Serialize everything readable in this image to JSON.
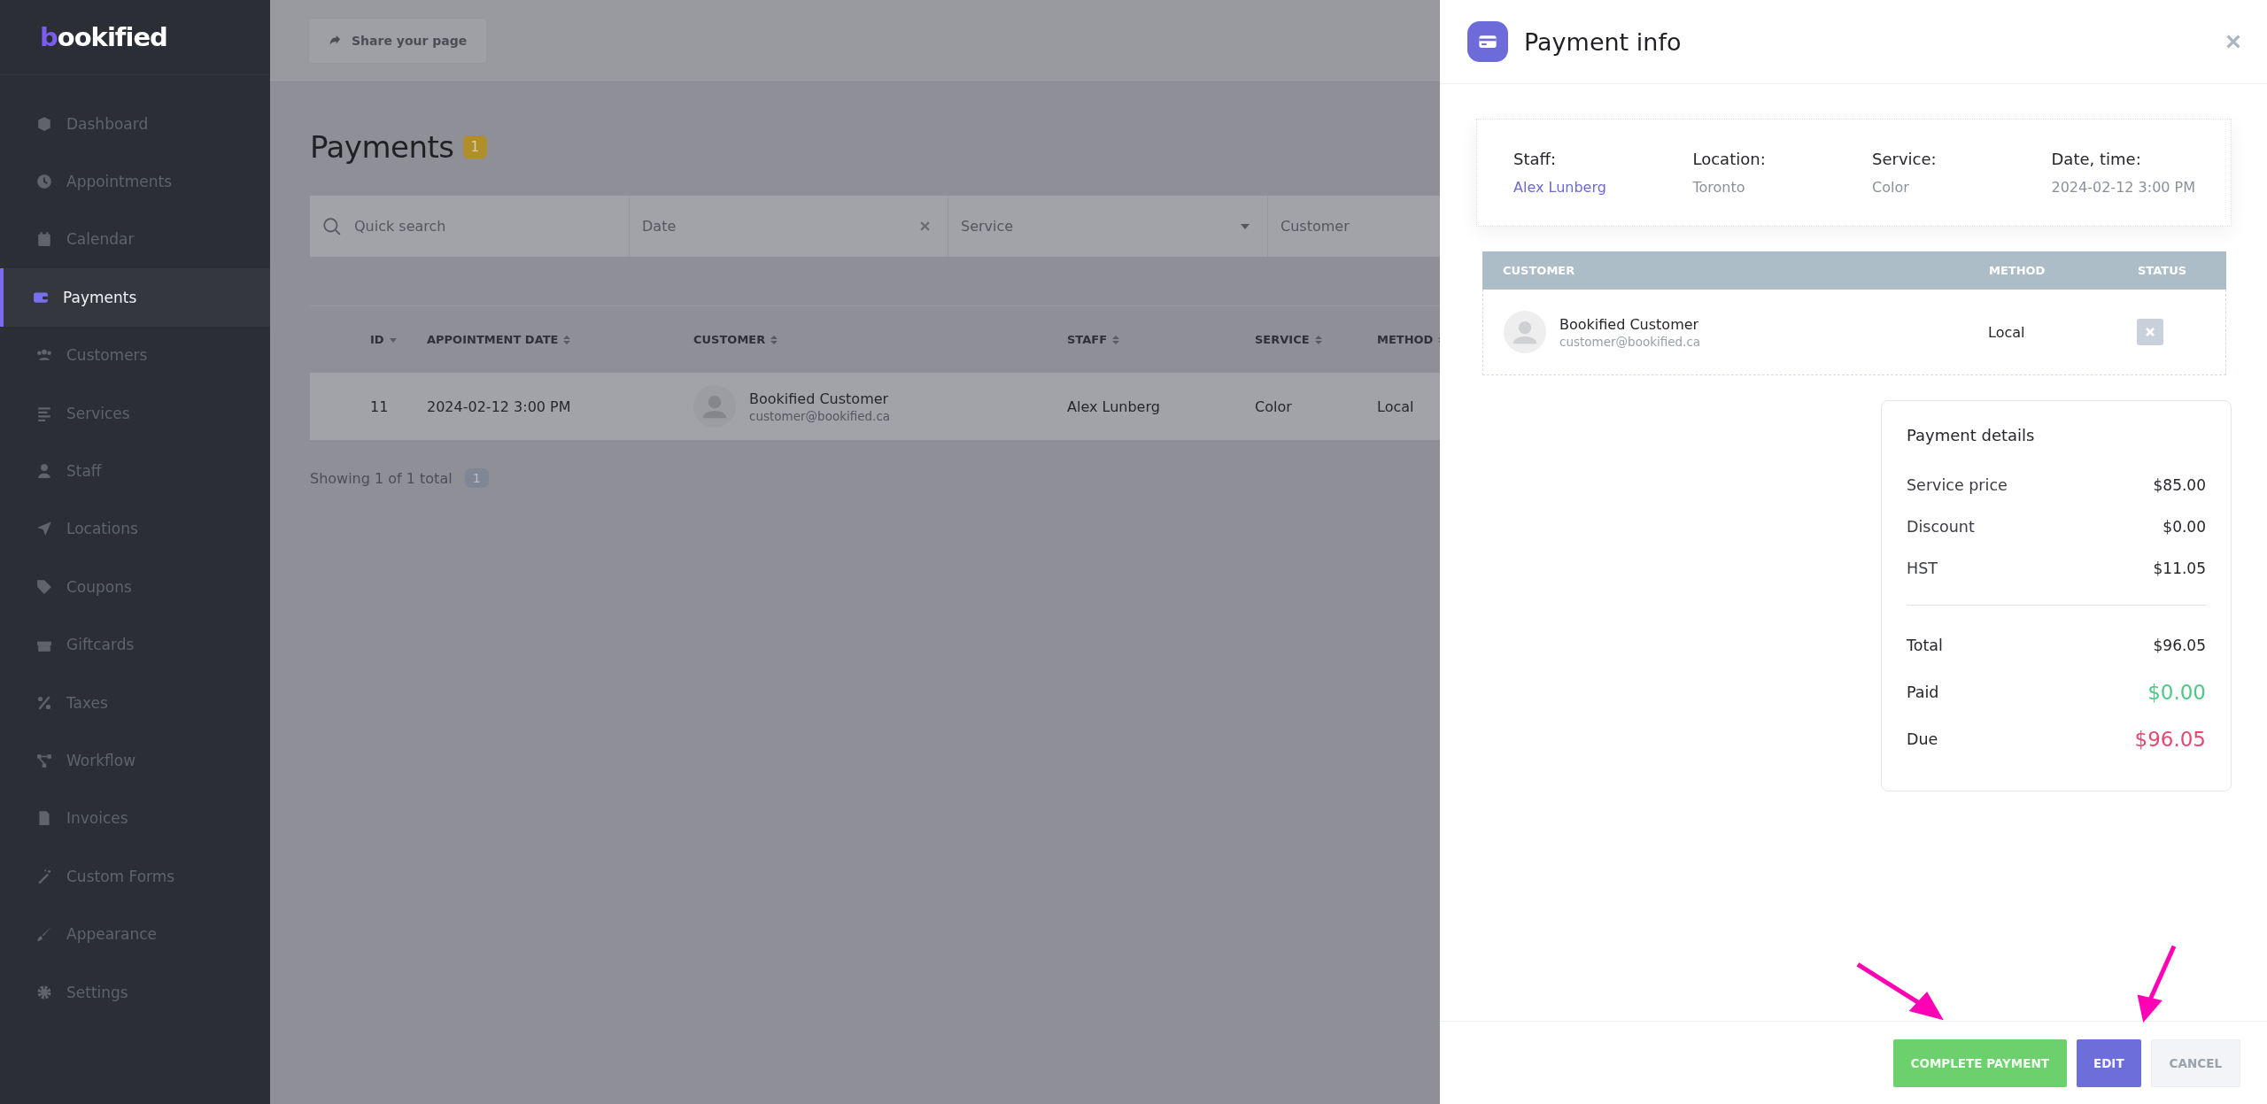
{
  "brand": {
    "mark": "b",
    "name": "ookified"
  },
  "sidebar": {
    "items": [
      {
        "label": "Dashboard",
        "selected": false
      },
      {
        "label": "Appointments",
        "selected": false
      },
      {
        "label": "Calendar",
        "selected": false
      },
      {
        "label": "Payments",
        "selected": true
      },
      {
        "label": "Customers",
        "selected": false
      },
      {
        "label": "Services",
        "selected": false
      },
      {
        "label": "Staff",
        "selected": false
      },
      {
        "label": "Locations",
        "selected": false
      },
      {
        "label": "Coupons",
        "selected": false
      },
      {
        "label": "Giftcards",
        "selected": false
      },
      {
        "label": "Taxes",
        "selected": false
      },
      {
        "label": "Workflow",
        "selected": false
      },
      {
        "label": "Invoices",
        "selected": false
      },
      {
        "label": "Custom Forms",
        "selected": false
      },
      {
        "label": "Appearance",
        "selected": false
      },
      {
        "label": "Settings",
        "selected": false
      }
    ]
  },
  "topbar": {
    "share_button": "Share your page"
  },
  "page": {
    "title": "Payments",
    "count": "1"
  },
  "filters": [
    {
      "kind": "search",
      "placeholder": "Quick search"
    },
    {
      "kind": "clearable",
      "placeholder": "Date"
    },
    {
      "kind": "dropdown",
      "placeholder": "Service"
    },
    {
      "kind": "plain",
      "placeholder": "Customer"
    }
  ],
  "table": {
    "columns": [
      {
        "label": "ID",
        "sorted": true
      },
      {
        "label": "APPOINTMENT DATE",
        "sorted": false
      },
      {
        "label": "CUSTOMER",
        "sorted": false
      },
      {
        "label": "STAFF",
        "sorted": false
      },
      {
        "label": "SERVICE",
        "sorted": false
      },
      {
        "label": "METHOD",
        "sorted": false
      }
    ],
    "rows": [
      {
        "id": "11",
        "date": "2024-02-12 3:00 PM",
        "customer_name": "Bookified Customer",
        "customer_email": "customer@bookified.ca",
        "staff": "Alex Lunberg",
        "service": "Color",
        "method": "Local"
      }
    ]
  },
  "footer": {
    "showing": "Showing 1 of 1 total",
    "page": "1"
  },
  "panel": {
    "title": "Payment info",
    "info": [
      {
        "label": "Staff:",
        "value": "Alex Lunberg",
        "kind": "link"
      },
      {
        "label": "Location:",
        "value": "Toronto",
        "kind": "text"
      },
      {
        "label": "Service:",
        "value": "Color",
        "kind": "text"
      },
      {
        "label": "Date, time:",
        "value": "2024-02-12 3:00 PM",
        "kind": "text"
      }
    ],
    "customers": {
      "columns": [
        "CUSTOMER",
        "METHOD",
        "STATUS"
      ],
      "rows": [
        {
          "name": "Bookified Customer",
          "email": "customer@bookified.ca",
          "method": "Local",
          "paid": false
        }
      ]
    },
    "details": {
      "title": "Payment details",
      "lines": [
        {
          "label": "Service price",
          "value": "$85.00",
          "kind": "line"
        },
        {
          "label": "Discount",
          "value": "$0.00",
          "kind": "line"
        },
        {
          "label": "HST",
          "value": "$11.05",
          "kind": "line"
        },
        {
          "label": "Total",
          "value": "$96.05",
          "kind": "total"
        },
        {
          "label": "Paid",
          "value": "$0.00",
          "kind": "paid"
        },
        {
          "label": "Due",
          "value": "$96.05",
          "kind": "due"
        }
      ]
    },
    "buttons": [
      {
        "label": "COMPLETE PAYMENT",
        "kind": "success"
      },
      {
        "label": "EDIT",
        "kind": "primary"
      },
      {
        "label": "CANCEL",
        "kind": "secondary"
      }
    ]
  }
}
